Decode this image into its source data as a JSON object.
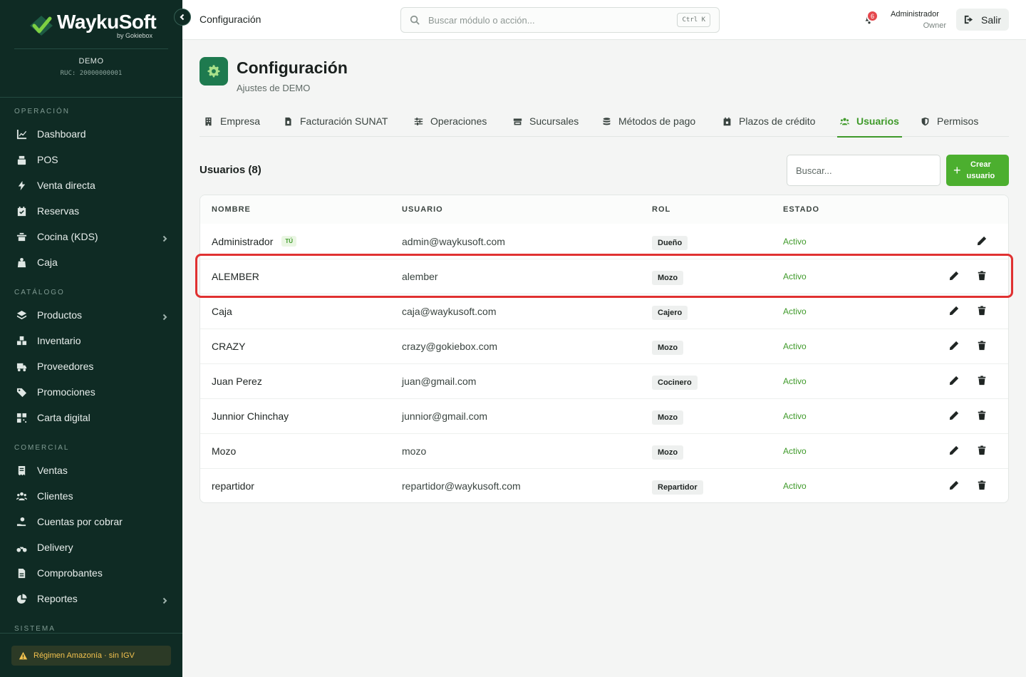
{
  "brand": {
    "name": "WaykuSoft",
    "sub": "by Gokiebox"
  },
  "tenant": {
    "name": "DEMO",
    "ruc": "RUC: 20000000001"
  },
  "nav": [
    {
      "title": "OPERACIÓN",
      "items": [
        {
          "label": "Dashboard",
          "icon": "chart-line-icon"
        },
        {
          "label": "POS",
          "icon": "cash-register-icon"
        },
        {
          "label": "Venta directa",
          "icon": "bolt-icon"
        },
        {
          "label": "Reservas",
          "icon": "calendar-check-icon"
        },
        {
          "label": "Cocina (KDS)",
          "icon": "kitchen-icon",
          "expandable": true
        },
        {
          "label": "Caja",
          "icon": "cash-box-icon"
        }
      ]
    },
    {
      "title": "CATÁLOGO",
      "items": [
        {
          "label": "Productos",
          "icon": "layers-icon",
          "expandable": true
        },
        {
          "label": "Inventario",
          "icon": "boxes-icon"
        },
        {
          "label": "Proveedores",
          "icon": "truck-icon"
        },
        {
          "label": "Promociones",
          "icon": "tags-icon"
        },
        {
          "label": "Carta digital",
          "icon": "qrcode-icon"
        }
      ]
    },
    {
      "title": "COMERCIAL",
      "items": [
        {
          "label": "Ventas",
          "icon": "receipt-icon"
        },
        {
          "label": "Clientes",
          "icon": "users-icon"
        },
        {
          "label": "Cuentas por cobrar",
          "icon": "hand-coin-icon"
        },
        {
          "label": "Delivery",
          "icon": "motorcycle-icon"
        },
        {
          "label": "Comprobantes",
          "icon": "file-icon"
        },
        {
          "label": "Reportes",
          "icon": "pie-chart-icon",
          "expandable": true
        }
      ]
    },
    {
      "title": "SISTEMA",
      "items": []
    }
  ],
  "regimen": "Régimen Amazonía · sin IGV",
  "topbar": {
    "title": "Configuración",
    "search_placeholder": "Buscar módulo o acción...",
    "shortcut": "Ctrl K",
    "notifications": "6",
    "user_name": "Administrador",
    "user_role": "Owner",
    "logout": "Salir"
  },
  "page": {
    "title": "Configuración",
    "subtitle": "Ajustes de DEMO"
  },
  "tabs": [
    {
      "label": "Empresa",
      "icon": "building-icon"
    },
    {
      "label": "Facturación SUNAT",
      "icon": "invoice-icon"
    },
    {
      "label": "Operaciones",
      "icon": "sliders-icon"
    },
    {
      "label": "Sucursales",
      "icon": "store-icon"
    },
    {
      "label": "Métodos de pago",
      "icon": "coins-icon"
    },
    {
      "label": "Plazos de crédito",
      "icon": "calendar-icon"
    },
    {
      "label": "Usuarios",
      "icon": "users-icon",
      "active": true
    },
    {
      "label": "Permisos",
      "icon": "shield-icon"
    }
  ],
  "users": {
    "title": "Usuarios (8)",
    "search_placeholder": "Buscar...",
    "create_label_1": "Crear",
    "create_label_2": "usuario",
    "headers": {
      "name": "NOMBRE",
      "user": "USUARIO",
      "role": "ROL",
      "status": "ESTADO"
    },
    "you_badge": "TÚ",
    "rows": [
      {
        "name": "Administrador",
        "user": "admin@waykusoft.com",
        "role": "Dueño",
        "status": "Activo",
        "is_you": true
      },
      {
        "name": "ALEMBER",
        "user": "alember",
        "role": "Mozo",
        "status": "Activo"
      },
      {
        "name": "Caja",
        "user": "caja@waykusoft.com",
        "role": "Cajero",
        "status": "Activo"
      },
      {
        "name": "CRAZY",
        "user": "crazy@gokiebox.com",
        "role": "Mozo",
        "status": "Activo"
      },
      {
        "name": "Juan Perez",
        "user": "juan@gmail.com",
        "role": "Cocinero",
        "status": "Activo"
      },
      {
        "name": "Junnior Chinchay",
        "user": "junnior@gmail.com",
        "role": "Mozo",
        "status": "Activo"
      },
      {
        "name": "Mozo",
        "user": "mozo",
        "role": "Mozo",
        "status": "Activo"
      },
      {
        "name": "repartidor",
        "user": "repartidor@waykusoft.com",
        "role": "Repartidor",
        "status": "Activo"
      }
    ]
  },
  "colors": {
    "sidebar": "#0f2b24",
    "accent": "#4caf2f",
    "highlight": "#e03131",
    "status_active": "#3f9a2a"
  }
}
